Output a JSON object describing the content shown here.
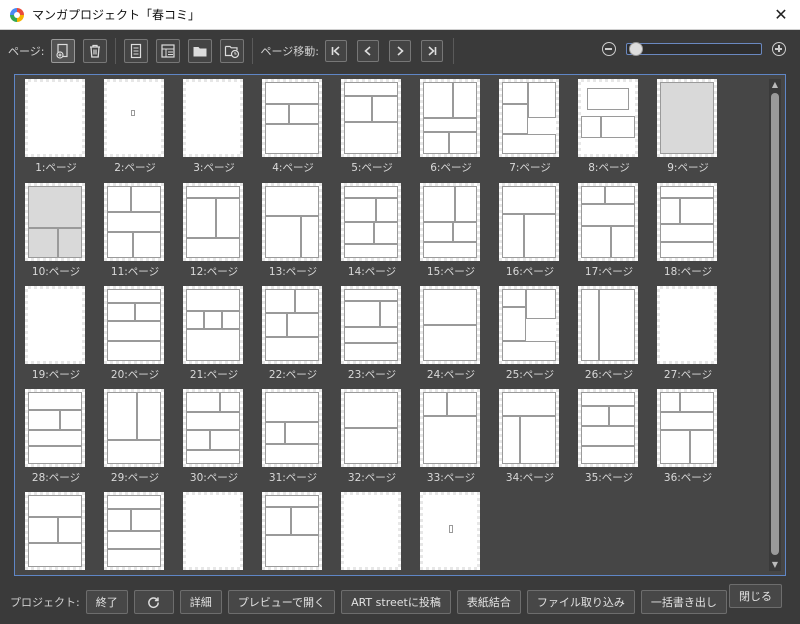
{
  "window": {
    "title": "マンガプロジェクト「春コミ」"
  },
  "toolbar": {
    "page_label": "ページ:",
    "move_label": "ページ移動:",
    "icons": [
      "add-page-icon",
      "trash-icon",
      "page-settings-icon",
      "page-layout-icon",
      "folder-icon",
      "folder-clock-icon"
    ],
    "nav_icons": [
      "first-page-icon",
      "prev-page-icon",
      "next-page-icon",
      "last-page-icon"
    ]
  },
  "zoom": {
    "level": 0.03
  },
  "pages": [
    {
      "label": "1:ページ"
    },
    {
      "label": "2:ページ"
    },
    {
      "label": "3:ページ"
    },
    {
      "label": "4:ページ"
    },
    {
      "label": "5:ページ"
    },
    {
      "label": "6:ページ"
    },
    {
      "label": "7:ページ"
    },
    {
      "label": "8:ページ"
    },
    {
      "label": "9:ページ"
    },
    {
      "label": "10:ページ"
    },
    {
      "label": "11:ページ"
    },
    {
      "label": "12:ページ"
    },
    {
      "label": "13:ページ"
    },
    {
      "label": "14:ページ"
    },
    {
      "label": "15:ページ"
    },
    {
      "label": "16:ページ"
    },
    {
      "label": "17:ページ"
    },
    {
      "label": "18:ページ"
    },
    {
      "label": "19:ページ"
    },
    {
      "label": "20:ページ"
    },
    {
      "label": "21:ページ"
    },
    {
      "label": "22:ページ"
    },
    {
      "label": "23:ページ"
    },
    {
      "label": "24:ページ"
    },
    {
      "label": "25:ページ"
    },
    {
      "label": "26:ページ"
    },
    {
      "label": "27:ページ"
    },
    {
      "label": "28:ページ"
    },
    {
      "label": "29:ページ"
    },
    {
      "label": "30:ページ"
    },
    {
      "label": "31:ページ"
    },
    {
      "label": "32:ページ"
    },
    {
      "label": "33:ページ"
    },
    {
      "label": "34:ページ"
    },
    {
      "label": "35:ページ"
    },
    {
      "label": "36:ページ"
    },
    {
      "label": ""
    },
    {
      "label": ""
    },
    {
      "label": ""
    },
    {
      "label": ""
    },
    {
      "label": ""
    },
    {
      "label": ""
    }
  ],
  "footer": {
    "project_label": "プロジェクト:",
    "buttons": {
      "end": "終了",
      "details": "詳細",
      "preview": "プレビューで開く",
      "art_street": "ART streetに投稿",
      "cover_combine": "表紙結合",
      "import": "ファイル取り込み",
      "batch_export": "一括書き出し",
      "close": "閉じる"
    }
  }
}
